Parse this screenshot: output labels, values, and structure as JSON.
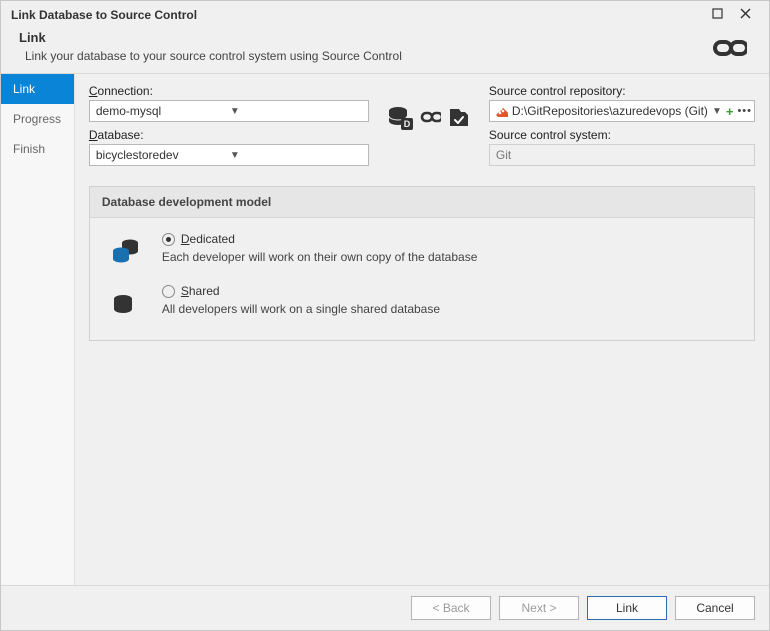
{
  "window": {
    "title": "Link Database to Source Control"
  },
  "header": {
    "title": "Link",
    "description": "Link your database to your source control system using Source Control"
  },
  "sidebar": {
    "items": [
      {
        "label": "Link",
        "active": true
      },
      {
        "label": "Progress",
        "active": false
      },
      {
        "label": "Finish",
        "active": false
      }
    ]
  },
  "form": {
    "connection_label": "Connection:",
    "connection_value": "demo-mysql",
    "database_label": "Database:",
    "database_value": "bicyclestoredev",
    "repo_label": "Source control repository:",
    "repo_value": "D:\\GitRepositories\\azuredevops (Git)",
    "scs_label": "Source control system:",
    "scs_value": "Git"
  },
  "panel": {
    "title": "Database development model",
    "dedicated": {
      "label": "Dedicated",
      "desc": "Each developer will work on their own copy of the database",
      "selected": true
    },
    "shared": {
      "label": "Shared",
      "desc": "All developers will work on a single shared database",
      "selected": false
    }
  },
  "footer": {
    "back": "< Back",
    "next": "Next >",
    "link": "Link",
    "cancel": "Cancel"
  }
}
